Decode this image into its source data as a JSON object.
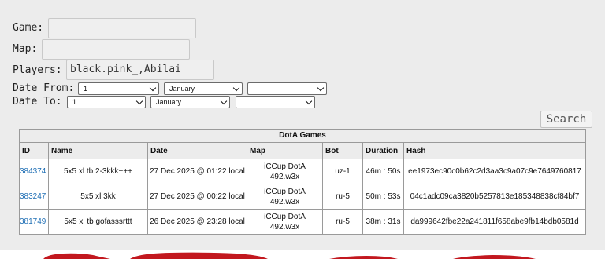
{
  "form": {
    "game_label": "Game:",
    "map_label": "Map:",
    "players_label": "Players:",
    "players_value": "black.pink_,Abilai",
    "date_from_label": "Date From:",
    "date_to_label": "Date To:",
    "from_day": "1",
    "from_month": "January",
    "from_year": "",
    "to_day": "1",
    "to_month": "January",
    "to_year": "",
    "search_label": "Search"
  },
  "table": {
    "caption": "DotA Games",
    "headers": [
      "ID",
      "Name",
      "Date",
      "Map",
      "Bot",
      "Duration",
      "Hash"
    ],
    "rows": [
      {
        "id": "384374",
        "name": "5x5 xl tb 2-3kkk+++",
        "date": "27 Dec 2025 @ 01:22 local",
        "map1": "iCCup DotA",
        "map2": "492.w3x",
        "bot": "uz-1",
        "duration": "46m : 50s",
        "hash": "ee1973ec90c0b62c2d3aa3c9a07c9e7649760817"
      },
      {
        "id": "383247",
        "name": "5x5 xl 3kk",
        "date": "27 Dec 2025 @ 00:22 local",
        "map1": "iCCup DotA",
        "map2": "492.w3x",
        "bot": "ru-5",
        "duration": "50m : 53s",
        "hash": "04c1adc09ca3820b5257813e185348838cf84bf7"
      },
      {
        "id": "381749",
        "name": "5x5 xl tb gofasssrttt",
        "date": "26 Dec 2025 @ 23:28 local",
        "map1": "iCCup DotA",
        "map2": "492.w3x",
        "bot": "ru-5",
        "duration": "38m : 31s",
        "hash": "da999642fbe22a241811f658abe9fb14bdb0581d"
      }
    ]
  },
  "colors": {
    "panel_bg": "#ececec",
    "link": "#1f6fb5",
    "footer_blob": "#c2181f"
  }
}
